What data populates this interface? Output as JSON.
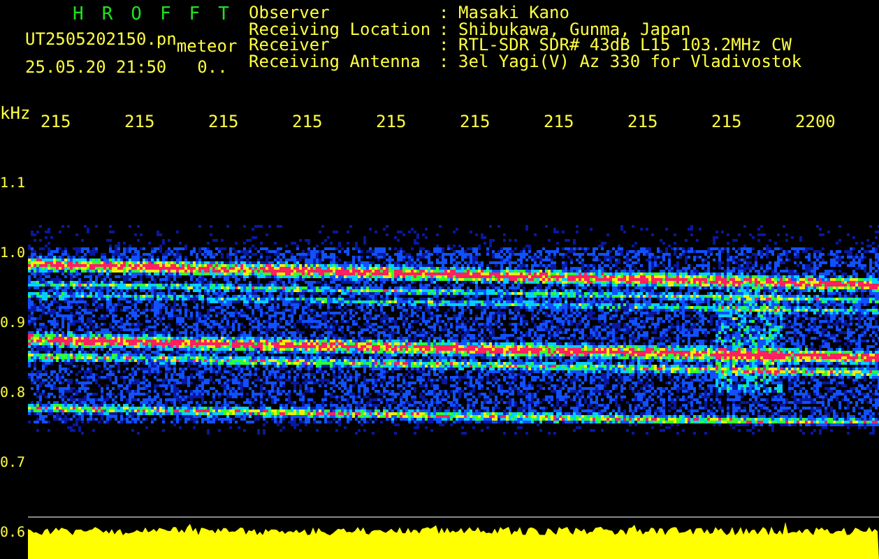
{
  "header": {
    "title": "HROFFT",
    "file_name": "UT2505202150.pn",
    "mode": "meteor",
    "timestamp": "25.05.20 21:50",
    "count": "0..",
    "fields": [
      {
        "label": "Observer",
        "separator": ":",
        "value": "Masaki Kano"
      },
      {
        "label": "Receiving Location",
        "separator": ":",
        "value": "Shibukawa, Gunma, Japan"
      },
      {
        "label": "Receiver",
        "separator": ":",
        "value": "RTL-SDR SDR# 43dB L15 103.2MHz CW"
      },
      {
        "label": "Receiving Antenna",
        "separator": ":",
        "value": "3el Yagi(V) Az 330 for Vladivostok"
      }
    ]
  },
  "time_axis": {
    "labels": [
      "215",
      "215",
      "215",
      "215",
      "215",
      "215",
      "215",
      "215",
      "215",
      "2200"
    ]
  },
  "frequency_axis": {
    "unit": "kHz",
    "labels": [
      "1.1",
      "1.0",
      "0.9",
      "0.8",
      "0.7",
      "0.6"
    ]
  }
}
